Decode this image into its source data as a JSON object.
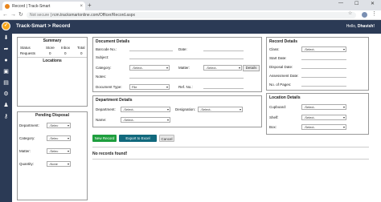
{
  "browser": {
    "tab_title": "Record | Track-Smart",
    "tab_close": "×",
    "new_tab": "+",
    "url_prefix": "Not secure",
    "url": "rcm.tracksmartonline.com/Officer/Record.aspx",
    "win_min": "—",
    "win_max": "☐",
    "win_close": "✕"
  },
  "header": {
    "title": "Track-Smart > Record",
    "greeting": "Hello,",
    "user": "Dhavish!"
  },
  "summary": {
    "title": "Summary",
    "columns": [
      "Status",
      "Store",
      "Inbox",
      "Total"
    ],
    "row_label": "Requests",
    "values": [
      "0",
      "0",
      "0"
    ],
    "locations_title": "Locations"
  },
  "pending": {
    "title": "Pending Disposal",
    "department_label": "Department:",
    "department_value": "-Selec",
    "category_label": "Category:",
    "category_value": "-Selec",
    "matter_label": "Matter:",
    "matter_value": "-Selec",
    "quantity_label": "Quantity:",
    "quantity_value": "-None"
  },
  "document": {
    "title": "Document Details",
    "barcode_label": "Barcode No.:",
    "date_label": "Date:",
    "subject_label": "Subject:",
    "category_label": "Category:",
    "category_value": "-Select-",
    "matter_label": "Matter:",
    "matter_value": "-Select-",
    "details_button": "Details",
    "notes_label": "Notes:",
    "owner_label": "Owner:",
    "doctype_label": "Document Type:",
    "doctype_value": "File",
    "refno_label": "Ref. No.:"
  },
  "department": {
    "title": "Department Details",
    "department_label": "Department:",
    "department_value": "-Select-",
    "designation_label": "Designation:",
    "designation_value": "-Select-",
    "name_label": "Name:",
    "name_value": "-Select-"
  },
  "record": {
    "title": "Record Details",
    "class_label": "Class:",
    "class_value": "-Select-",
    "start_label": "Start Date:",
    "disposal_label": "Disposal Date:",
    "assessment_label": "Assessment Date:",
    "pages_label": "No. of Pages:"
  },
  "location": {
    "title": "Location Details",
    "cupboard_label": "Cupboard:",
    "cupboard_value": "-Select-",
    "shelf_label": "Shelf:",
    "shelf_value": "-Select-",
    "box_label": "Box:",
    "box_value": "-Select-"
  },
  "actions": {
    "new_record": "New Record",
    "export": "Export to Excel",
    "cancel": "Cancel"
  },
  "results": {
    "message": "No records found!"
  },
  "colors": {
    "nav_bg": "#2b3a55",
    "new_record_bg": "#1e9e3e",
    "export_bg": "#11697d",
    "logo": "#f7a71b"
  }
}
